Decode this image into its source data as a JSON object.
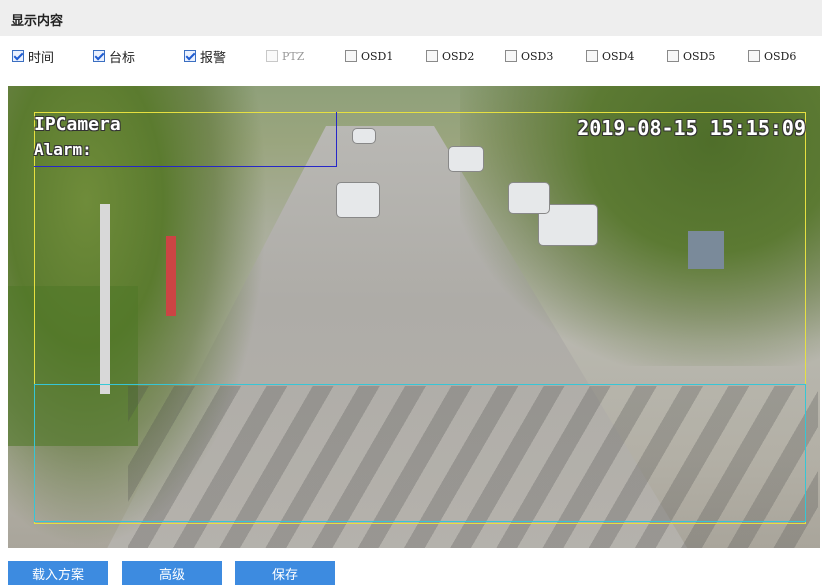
{
  "section": {
    "title": "显示内容"
  },
  "checkboxes": [
    {
      "label": "时间",
      "checked": true,
      "disabled": false
    },
    {
      "label": "台标",
      "checked": true,
      "disabled": false
    },
    {
      "label": "报警",
      "checked": true,
      "disabled": false
    },
    {
      "label": "PTZ",
      "checked": false,
      "disabled": true
    },
    {
      "label": "OSD1",
      "checked": false,
      "disabled": false
    },
    {
      "label": "OSD2",
      "checked": false,
      "disabled": false
    },
    {
      "label": "OSD3",
      "checked": false,
      "disabled": false
    },
    {
      "label": "OSD4",
      "checked": false,
      "disabled": false
    },
    {
      "label": "OSD5",
      "checked": false,
      "disabled": false
    },
    {
      "label": "OSD6",
      "checked": false,
      "disabled": false
    }
  ],
  "video": {
    "osd_name": "IPCamera",
    "osd_alarm": "Alarm:",
    "osd_time": "2019-08-15 15:15:09"
  },
  "buttons": {
    "load": "载入方案",
    "advanced": "高级",
    "save": "保存"
  },
  "colors": {
    "button": "#3d8be0",
    "yellow_box": "#e6e040",
    "blue_box": "#2626c8",
    "cyan_box": "#36c6d6"
  }
}
